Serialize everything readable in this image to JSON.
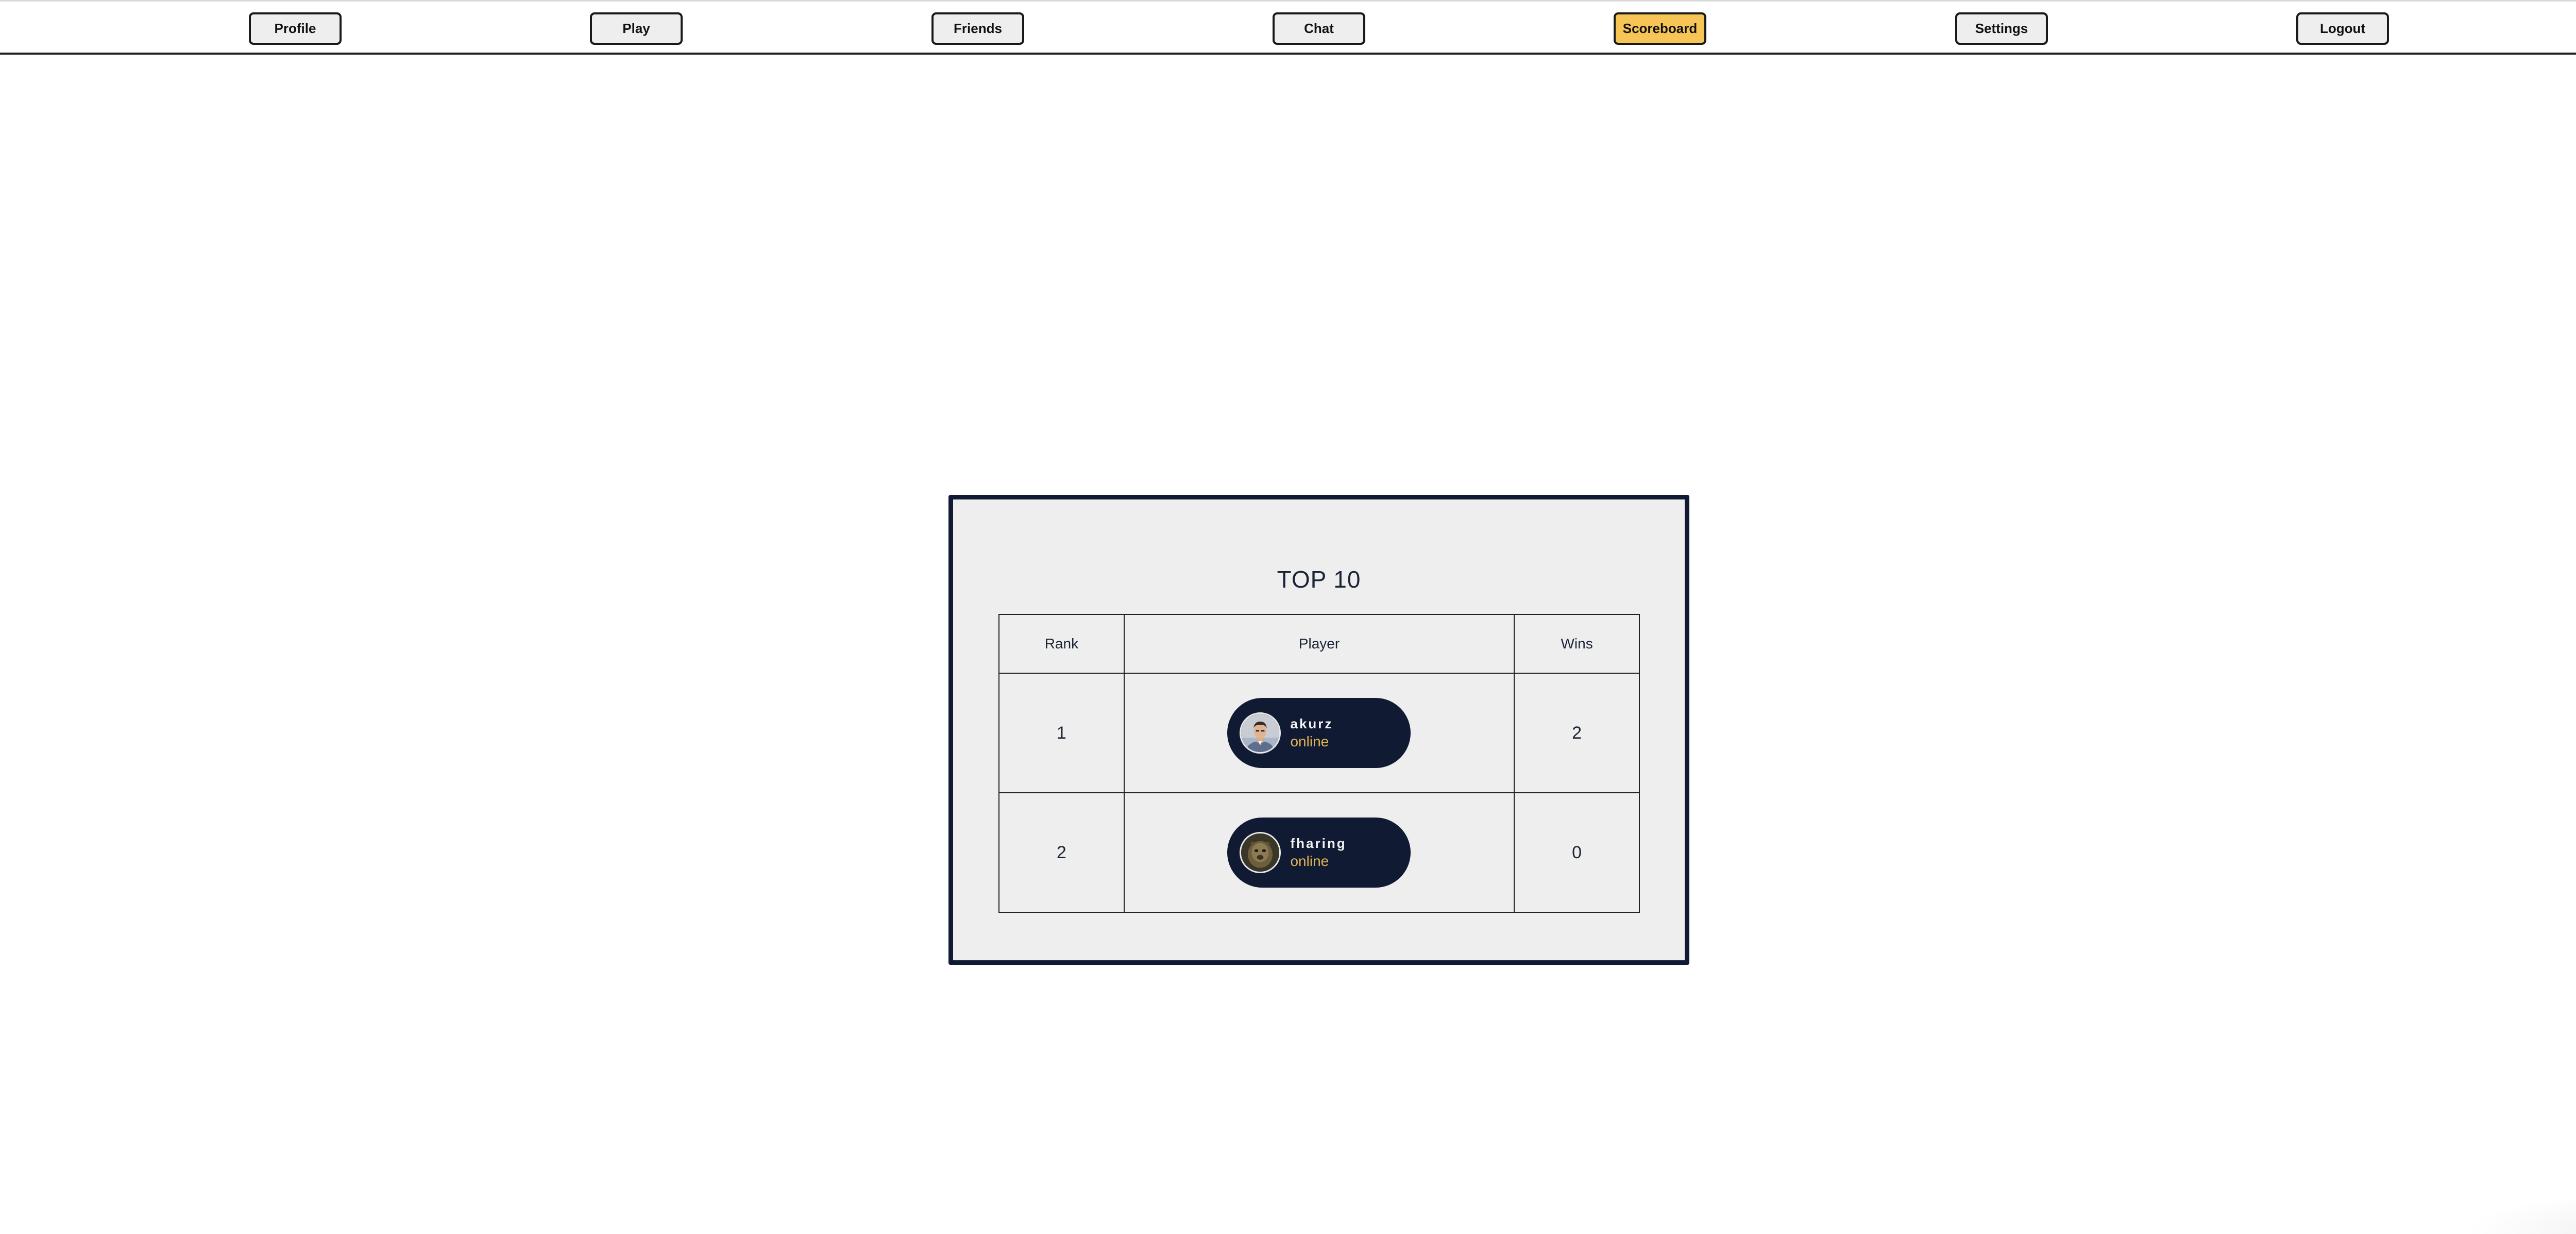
{
  "nav": {
    "items": [
      {
        "label": "Profile",
        "active": false
      },
      {
        "label": "Play",
        "active": false
      },
      {
        "label": "Friends",
        "active": false
      },
      {
        "label": "Chat",
        "active": false
      },
      {
        "label": "Scoreboard",
        "active": true
      },
      {
        "label": "Settings",
        "active": false
      },
      {
        "label": "Logout",
        "active": false
      }
    ],
    "active_color": "#f6c556",
    "button_color": "#eeeeee"
  },
  "scoreboard": {
    "title": "TOP 10",
    "columns": [
      "Rank",
      "Player",
      "Wins"
    ],
    "rows": [
      {
        "rank": "1",
        "player": {
          "name": "akurz",
          "status": "online",
          "avatar": "person-photo-avatar"
        },
        "wins": "2"
      },
      {
        "rank": "2",
        "player": {
          "name": "fharing",
          "status": "online",
          "avatar": "animal-photo-avatar"
        },
        "wins": "0"
      }
    ],
    "card_border_color": "#101a33",
    "pill_color": "#111a33",
    "status_color": "#e0b454"
  }
}
